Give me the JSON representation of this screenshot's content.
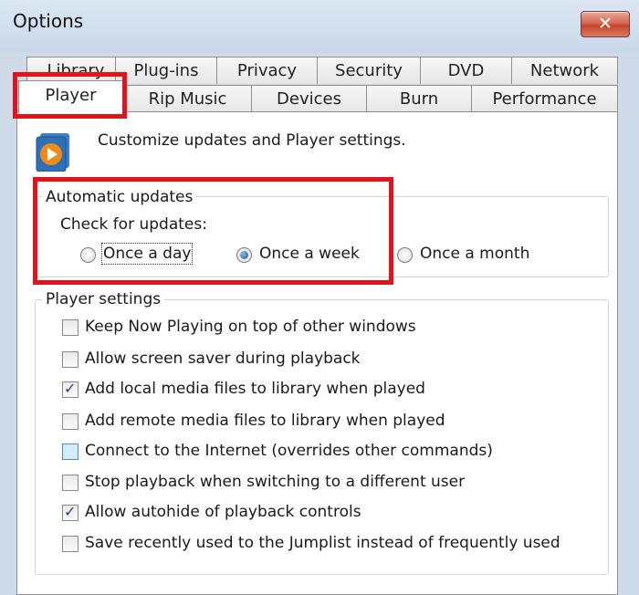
{
  "window": {
    "title": "Options",
    "close_label": "✕"
  },
  "tabs": {
    "row1": [
      {
        "name": "tab-library",
        "label": "Library"
      },
      {
        "name": "tab-plug-ins",
        "label": "Plug-ins"
      },
      {
        "name": "tab-privacy",
        "label": "Privacy"
      },
      {
        "name": "tab-security",
        "label": "Security"
      },
      {
        "name": "tab-dvd",
        "label": "DVD"
      },
      {
        "name": "tab-network",
        "label": "Network"
      }
    ],
    "row2": [
      {
        "name": "tab-player",
        "label": "Player",
        "selected": true
      },
      {
        "name": "tab-rip-music",
        "label": "Rip Music"
      },
      {
        "name": "tab-devices",
        "label": "Devices"
      },
      {
        "name": "tab-burn",
        "label": "Burn"
      },
      {
        "name": "tab-performance",
        "label": "Performance"
      }
    ]
  },
  "intro": "Customize updates and Player settings.",
  "updates": {
    "legend": "Automatic updates",
    "check_label": "Check for updates:",
    "options": [
      {
        "label": "Once a day",
        "checked": false
      },
      {
        "label": "Once a week",
        "checked": true
      },
      {
        "label": "Once a month",
        "checked": false
      }
    ]
  },
  "player_settings": {
    "legend": "Player settings",
    "items": [
      {
        "label": "Keep Now Playing on top of other windows",
        "checked": false
      },
      {
        "label": "Allow screen saver during playback",
        "checked": false
      },
      {
        "label": "Add local media files to library when played",
        "checked": true
      },
      {
        "label": "Add remote media files to library when played",
        "checked": false
      },
      {
        "label": "Connect to the Internet (overrides other commands)",
        "checked": false,
        "focused": true
      },
      {
        "label": "Stop playback when switching to a different user",
        "checked": false
      },
      {
        "label": "Allow autohide of playback controls",
        "checked": true
      },
      {
        "label": "Save recently used to the Jumplist instead of frequently used",
        "checked": false
      }
    ]
  },
  "colors": {
    "highlight": "#e1141c",
    "window_bg": "#cfdbe9"
  },
  "icons": {
    "app": "media-player-icon",
    "close": "close-icon",
    "check": "checkmark-icon"
  }
}
